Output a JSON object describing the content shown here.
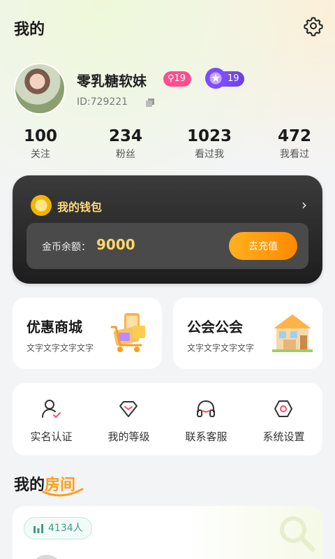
{
  "header": {
    "title": "我的"
  },
  "profile": {
    "nickname": "零乳糖软妹",
    "level_badge": "19",
    "vip_badge": "19",
    "user_id": "ID:729221"
  },
  "stats": [
    {
      "value": "100",
      "label": "关注"
    },
    {
      "value": "234",
      "label": "粉丝"
    },
    {
      "value": "1023",
      "label": "看过我"
    },
    {
      "value": "472",
      "label": "我看过"
    }
  ],
  "wallet": {
    "title": "我的钱包",
    "balance_label": "金币余额：",
    "balance_value": "9000",
    "recharge_label": "去充值"
  },
  "cards": [
    {
      "title": "优惠商城",
      "subtitle": "文字文字文字文字",
      "icon": "shopping-cart-icon"
    },
    {
      "title": "公会公会",
      "subtitle": "文字文字文字文字",
      "icon": "house-icon"
    }
  ],
  "menu": [
    {
      "label": "实名认证",
      "icon": "user-verify-icon"
    },
    {
      "label": "我的等级",
      "icon": "diamond-icon"
    },
    {
      "label": "联系客服",
      "icon": "headset-icon"
    },
    {
      "label": "系统设置",
      "icon": "hex-settings-icon"
    }
  ],
  "rooms": {
    "section_prefix": "我的",
    "section_highlight": "房间",
    "viewer_count": "4134人"
  },
  "colors": {
    "accent_orange": "#ff9c1a",
    "level_pink": "#ff4d8d",
    "vip_purple": "#7c4dff",
    "gold": "#ffd86a",
    "teal": "#3b9e86"
  }
}
